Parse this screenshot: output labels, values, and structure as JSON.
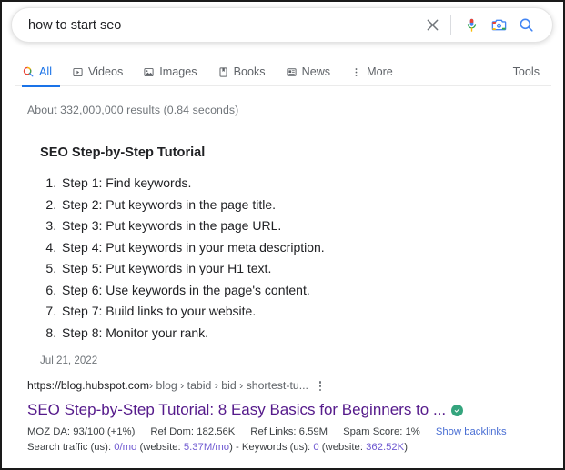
{
  "search": {
    "query": "how to start seo",
    "placeholder": "Search",
    "clear_icon": "close-icon",
    "voice_icon": "microphone-icon",
    "lens_icon": "camera-lens-icon",
    "submit_icon": "search-icon"
  },
  "nav": {
    "tabs": [
      {
        "label": "All",
        "icon": "search-icon",
        "active": true
      },
      {
        "label": "Videos",
        "icon": "video-icon",
        "active": false
      },
      {
        "label": "Images",
        "icon": "image-icon",
        "active": false
      },
      {
        "label": "Books",
        "icon": "book-icon",
        "active": false
      },
      {
        "label": "News",
        "icon": "news-icon",
        "active": false
      },
      {
        "label": "More",
        "icon": "kebab-icon",
        "active": false
      }
    ],
    "tools_label": "Tools"
  },
  "result_stats": "About 332,000,000 results (0.84 seconds)",
  "snippet": {
    "title": "SEO Step-by-Step Tutorial",
    "steps": [
      "Step 1: Find keywords.",
      "Step 2: Put keywords in the page title.",
      "Step 3: Put keywords in the page URL.",
      "Step 4: Put keywords in your meta description.",
      "Step 5: Put keywords in your H1 text.",
      "Step 6: Use keywords in the page's content.",
      "Step 7: Build links to your website.",
      "Step 8: Monitor your rank."
    ],
    "date": "Jul 21, 2022"
  },
  "result": {
    "url_domain": "https://blog.hubspot.com",
    "url_crumbs": " › blog › tabid › bid › shortest-tu...",
    "kebab_icon": "kebab-icon",
    "title": "SEO Step-by-Step Tutorial: 8 Easy Basics for Beginners to ...",
    "verified_icon": "verified-check-icon",
    "metrics": [
      "MOZ DA: 93/100 (+1%)",
      "Ref Dom: 182.56K",
      "Ref Links: 6.59M",
      "Spam Score: 1%"
    ],
    "backlinks_label": "Show backlinks",
    "traffic": {
      "label_1": "Search traffic (us): ",
      "value_1": "0/mo",
      "mid_1": " (website: ",
      "value_2": "5.37M/mo",
      "mid_2": ") - Keywords (us): ",
      "value_3": "0",
      "mid_3": " (website: ",
      "value_4": "362.52K",
      "tail": ")"
    }
  },
  "colors": {
    "accent_blue": "#1a73e8",
    "link_purple": "#551a8b",
    "metric_purple": "#6f5ad1",
    "verified_green": "#34a47d",
    "muted_gray": "#70757a"
  }
}
